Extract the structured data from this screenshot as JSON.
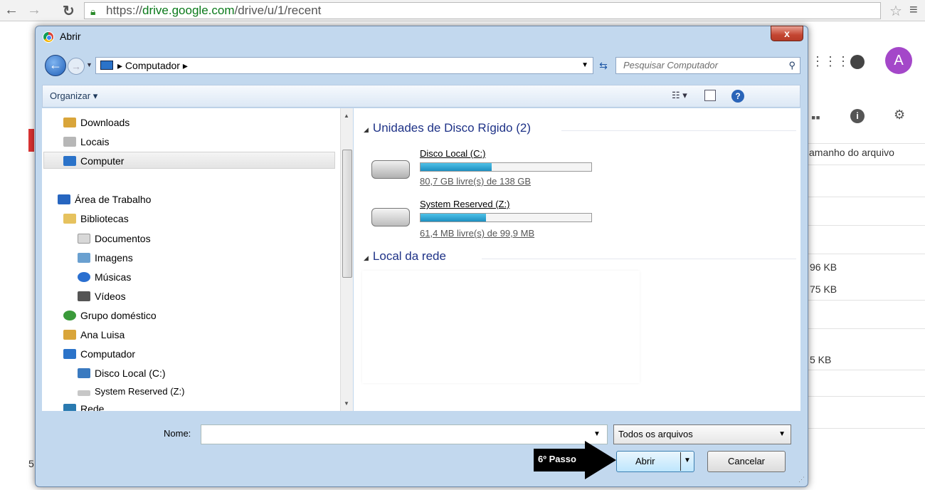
{
  "browser": {
    "url_prefix": "https://",
    "url_host": "drive.google.com",
    "url_path": "/drive/u/1/recent",
    "icons": [
      "back-arrow-icon",
      "forward-arrow-icon",
      "reload-icon",
      "lock-icon",
      "star-icon",
      "menu-icon"
    ]
  },
  "drive": {
    "avatar_letter": "A",
    "column_header": "amanho do arquivo",
    "sizes": [
      "96 KB",
      "75 KB",
      "5 KB"
    ],
    "row_label_bottom": "5"
  },
  "dialog": {
    "title": "Abrir",
    "close_label": "x",
    "address_crumb": "▸ Computador ▸",
    "search_placeholder": "Pesquisar Computador",
    "organize_label": "Organizar ▾",
    "nav_items": [
      {
        "label": "Downloads",
        "icon": "downloads-icon",
        "color": "#d9a53a"
      },
      {
        "label": "Locais",
        "icon": "places-icon",
        "color": "#b7b7b7"
      },
      {
        "label": "Computer",
        "icon": "computer-icon",
        "color": "#2b73c9",
        "selected": true
      },
      {
        "label": "Área de Trabalho",
        "icon": "desktop-icon",
        "color": "#2766c0"
      },
      {
        "label": "Bibliotecas",
        "icon": "libraries-icon",
        "color": "#e6c25e"
      },
      {
        "label": "Documentos",
        "icon": "document-icon",
        "color": "#d8d8d8"
      },
      {
        "label": "Imagens",
        "icon": "image-icon",
        "color": "#6aa0d0"
      },
      {
        "label": "Músicas",
        "icon": "music-icon",
        "color": "#2a6fd0"
      },
      {
        "label": "Vídeos",
        "icon": "video-icon",
        "color": "#555555"
      },
      {
        "label": "Grupo doméstico",
        "icon": "homegroup-icon",
        "color": "#3a9a3a"
      },
      {
        "label": "Ana Luisa",
        "icon": "user-folder-icon",
        "color": "#d9a53a"
      },
      {
        "label": "Computador",
        "icon": "computer-icon",
        "color": "#2b73c9"
      },
      {
        "label": "Disco Local (C:)",
        "icon": "disk-icon",
        "color": "#3a7ac0"
      },
      {
        "label": "System Reserved (Z:)",
        "icon": "disk-icon",
        "color": "#c7c7c7"
      },
      {
        "label": "Rede",
        "icon": "network-icon",
        "color": "#2a7ab0"
      }
    ],
    "section_disks": "Unidades de Disco Rígido (2)",
    "section_network": "Local da rede",
    "drives": [
      {
        "name": "Disco Local (C:)",
        "free": "80,7 GB livre(s) de 138 GB",
        "used_fraction": 0.415
      },
      {
        "name": "System Reserved (Z:)",
        "free": "61,4 MB livre(s) de 99,9 MB",
        "used_fraction": 0.385
      }
    ],
    "name_label": "Nome:",
    "name_value": "",
    "filter_label": "Todos os arquivos",
    "open_label": "Abrir",
    "cancel_label": "Cancelar",
    "annotation": "6º Passo"
  }
}
